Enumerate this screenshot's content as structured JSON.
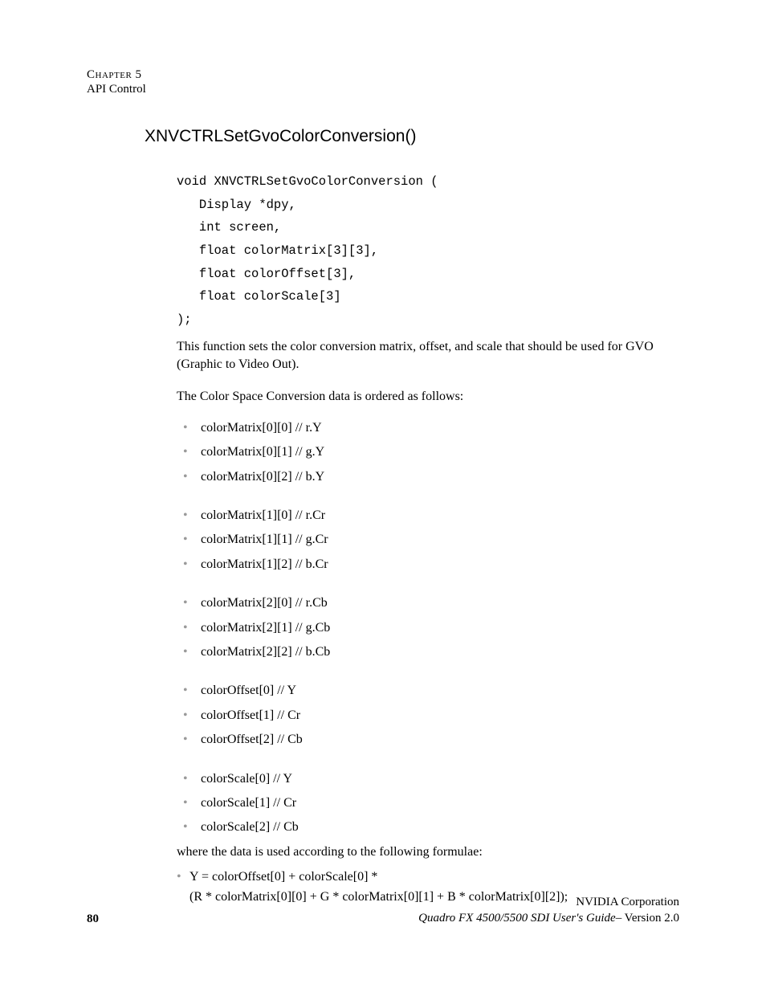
{
  "header": {
    "chapter": "Chapter 5",
    "section": "API Control"
  },
  "title": "XNVCTRLSetGvoColorConversion()",
  "code": "void XNVCTRLSetGvoColorConversion (\n   Display *dpy,\n   int screen,\n   float colorMatrix[3][3],\n   float colorOffset[3],\n   float colorScale[3]\n);",
  "para1": "This function sets the color conversion matrix, offset, and scale that should be used for GVO (Graphic to Video Out).",
  "para2": "The Color Space Conversion data is ordered as follows:",
  "groups": [
    [
      "colorMatrix[0][0] // r.Y",
      "colorMatrix[0][1] // g.Y",
      "colorMatrix[0][2] // b.Y"
    ],
    [
      "colorMatrix[1][0] // r.Cr",
      "colorMatrix[1][1] // g.Cr",
      "colorMatrix[1][2] // b.Cr"
    ],
    [
      "colorMatrix[2][0] // r.Cb",
      "colorMatrix[2][1] // g.Cb",
      "colorMatrix[2][2] // b.Cb"
    ],
    [
      "colorOffset[0]   // Y",
      "colorOffset[1]   // Cr",
      "colorOffset[2]   // Cb"
    ],
    [
      "colorScale[0]    // Y",
      "colorScale[1]    // Cr",
      "colorScale[2]    // Cb"
    ]
  ],
  "where": "where the data is used according to the following formulae:",
  "formula": {
    "line1": "Y  =  colorOffset[0] + colorScale[0] *",
    "line2": "(R * colorMatrix[0][0] + G * colorMatrix[0][1] + B * colorMatrix[0][2]);"
  },
  "footer": {
    "page": "80",
    "corp": "NVIDIA Corporation",
    "guide": "Quadro FX 4500/5500 SDI User's Guide",
    "version": "– Version 2.0"
  }
}
